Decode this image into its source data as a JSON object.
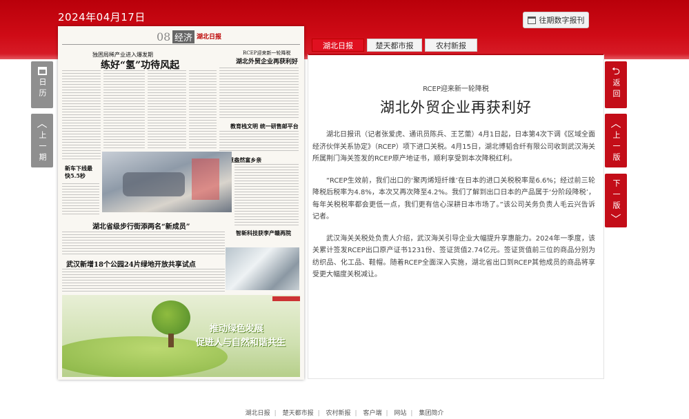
{
  "header": {
    "date": "2024年04月17日",
    "archive_button": "往期数字报刊"
  },
  "paper": {
    "page_no": "08",
    "section": "经济",
    "masthead": "湖北日报",
    "headlines": [
      "独困局稀产业进入爆发期",
      "练好“氢”功待风起",
      "RCEP迎来新一轮降税",
      "湖北外贸企业再获利好",
      "教育栈文明 统一研售邮平台",
      "“畅”意盎然富乡亲",
      "新车下线最快5.5秒",
      "湖北省级步行街添两名“新成员”",
      "智新科技获李产赣再院",
      "武汉新增18个公园24片绿地开放共享试点"
    ],
    "ad_slogan_1": "推动绿色发展",
    "ad_slogan_2": "促进人与自然和谐共生"
  },
  "tabs": [
    {
      "label": "湖北日报",
      "active": true
    },
    {
      "label": "楚天都市报",
      "active": false
    },
    {
      "label": "农村新报",
      "active": false
    }
  ],
  "article": {
    "kicker": "RCEP迎来新一轮降税",
    "title": "湖北外贸企业再获利好",
    "paragraphs": [
      "湖北日报讯（记者张爱虎、通讯员陈兵、王艺薷）4月1日起，日本第4次下调《区域全面经济伙伴关系协定》（RCEP）项下进口关税。4月15日，湖北博韬合纤有限公司收到武汉海关所属荆门海关签发的RCEP原产地证书，顺利享受到本次降税红利。",
      "“RCEP生效前，我们出口的‘聚丙烯短纤维’在日本的进口关税税率是6.6%；经过前三轮降税后税率为4.8%，本次又再次降至4.2%。我们了解到出口日本的产品属于‘分阶段降税’，每年关税税率都会更低一点，我们更有信心深耕日本市场了。”该公司关务负责人毛云兴告诉记者。",
      "武汉海关关税处负责人介绍，武汉海关引导企业大幅提升享惠能力。2024年一季度，该关累计签发RCEP出口原产证书1231份、签证货值2.74亿元。签证货值前三位的商品分别为纺织品、化工品、鞋帽。随着RCEP全面深入实施，湖北省出口到RCEP其他成员的商品将享受更大幅度关税减让。"
    ]
  },
  "left_nav": {
    "calendar": "日历",
    "prev_issue": "上一期"
  },
  "right_nav": {
    "back": "返回",
    "prev_page": "上一版",
    "next_page": "下一版"
  },
  "footer": {
    "links": [
      "湖北日报",
      "楚天都市报",
      "农村新报",
      "客户端",
      "网站",
      "集团简介"
    ]
  },
  "colors": {
    "brand_red": "#c30d18",
    "nav_grey": "#8f8f8f"
  }
}
